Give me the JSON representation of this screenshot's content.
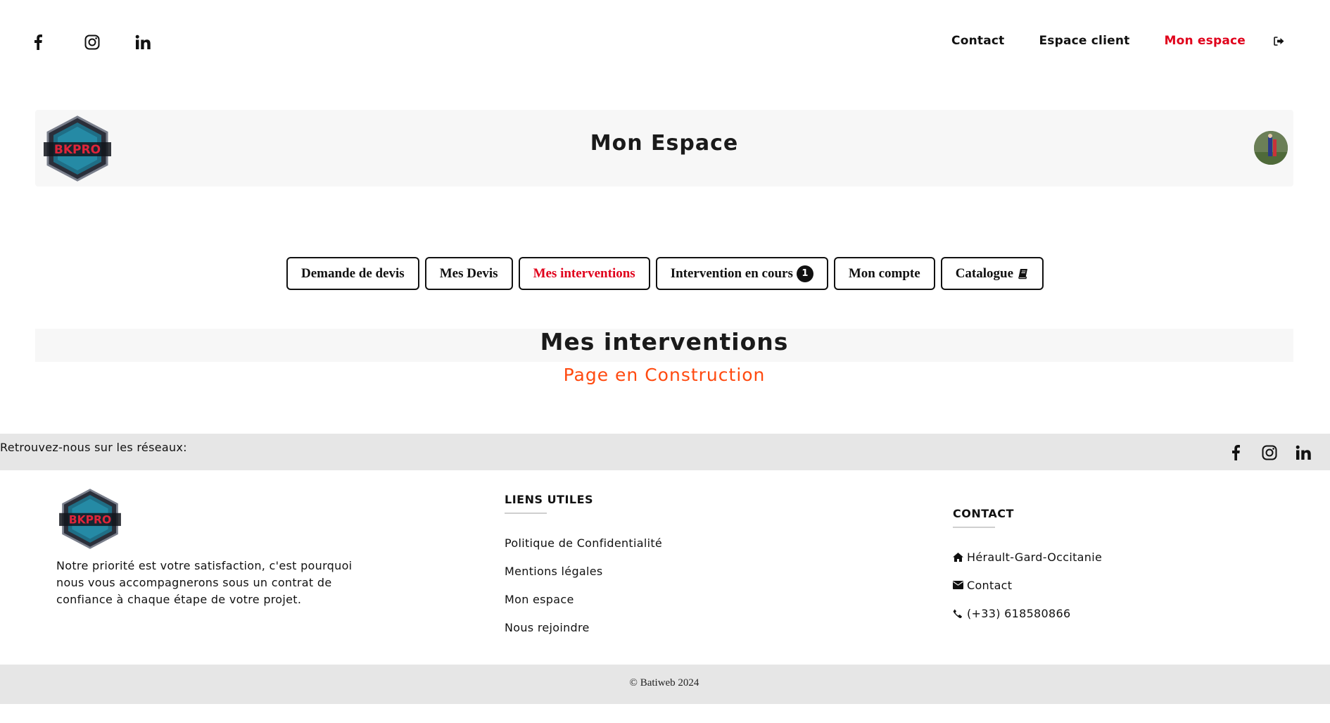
{
  "topbar": {
    "social": [
      {
        "icon": "facebook-icon"
      },
      {
        "icon": "instagram-icon"
      },
      {
        "icon": "linkedin-icon"
      }
    ],
    "nav": {
      "contact": "Contact",
      "client_space": "Espace client",
      "my_space": "Mon espace",
      "logout_icon": "sign-out-icon"
    },
    "accent_color": "#e0001b"
  },
  "header": {
    "logo_text": "BKPRO",
    "title": "Mon Espace",
    "avatar_icon": "user-avatar"
  },
  "tabs": [
    {
      "label": "Demande de devis"
    },
    {
      "label": "Mes Devis"
    },
    {
      "label": "Mes interventions",
      "active": true
    },
    {
      "label": "Intervention en cours",
      "badge": "1"
    },
    {
      "label": "Mon compte"
    },
    {
      "label": "Catalogue",
      "icon": "book-icon"
    }
  ],
  "section": {
    "title": "Mes interventions",
    "subtitle": "Page en Construction",
    "subtitle_color": "#ff4a10"
  },
  "follow": {
    "text": "Retrouvez-nous sur les réseaux:",
    "icons": [
      "facebook-icon",
      "instagram-icon",
      "linkedin-icon"
    ]
  },
  "footer": {
    "logo_text": "BKPRO",
    "description": "Notre priorité est votre satisfaction, c'est pourquoi nous vous accompagnerons sous un contrat de confiance à chaque étape de votre projet.",
    "links_heading": "LIENS UTILES",
    "links": [
      "Politique de Confidentialité",
      "Mentions légales",
      "Mon espace",
      "Nous rejoindre"
    ],
    "contact_heading": "CONTACT",
    "contact": {
      "region": "Hérault-Gard-Occitanie",
      "email_label": "Contact",
      "phone": "(+33) 618580866"
    }
  },
  "copyright": "© Batiweb 2024"
}
